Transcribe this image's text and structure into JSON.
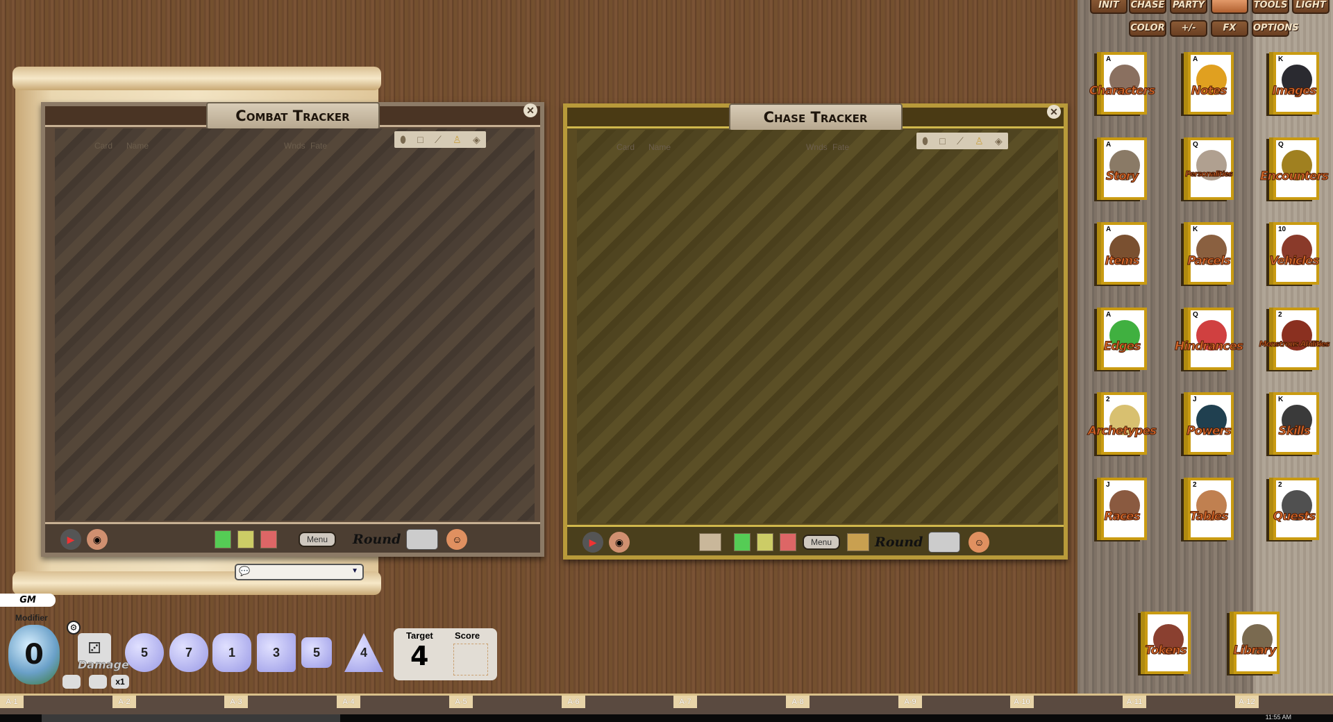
{
  "toolbar": {
    "row1": [
      "Init",
      "Chase",
      "Party",
      "",
      "Tools",
      "Light"
    ],
    "row2": [
      "Color",
      "+/-",
      "FX",
      "Options"
    ]
  },
  "combat_tracker": {
    "title": "Combat Tracker",
    "columns": {
      "card": "Card",
      "name": "Name",
      "wnds": "Wnds",
      "fate": "Fate"
    },
    "menu_label": "Menu",
    "round_label": "Round",
    "round_value": ""
  },
  "chase_tracker": {
    "title": "Chase Tracker",
    "columns": {
      "card": "Card",
      "name": "Name",
      "wnds": "Wnds",
      "fate": "Fate"
    },
    "menu_label": "Menu",
    "round_label": "Round",
    "round_value": ""
  },
  "chat": {
    "mode_value": ""
  },
  "identity": {
    "label": "GM"
  },
  "modifier": {
    "label": "Modifier",
    "value": "0"
  },
  "damage": {
    "label": "Damage",
    "multiplier": "x1"
  },
  "dice": [
    "d20",
    "d12",
    "d10",
    "d8",
    "d6",
    "d4"
  ],
  "dice_faces": [
    "5",
    "7",
    "1",
    "3",
    "5",
    "4"
  ],
  "target_score": {
    "target_label": "Target",
    "target_value": "4",
    "score_label": "Score",
    "score_value": ""
  },
  "library": [
    {
      "label": "Characters",
      "rank": "A",
      "color": "#8a7060"
    },
    {
      "label": "Notes",
      "rank": "A",
      "color": "#e0a020"
    },
    {
      "label": "Images",
      "rank": "K",
      "color": "#2a2a30"
    },
    {
      "label": "Story",
      "rank": "A",
      "color": "#8a7a66"
    },
    {
      "label": "Personalities",
      "rank": "Q",
      "color": "#b0a090"
    },
    {
      "label": "Encounters",
      "rank": "Q",
      "color": "#a08020"
    },
    {
      "label": "Items",
      "rank": "A",
      "color": "#7a5030"
    },
    {
      "label": "Parcels",
      "rank": "K",
      "color": "#8a6040"
    },
    {
      "label": "Vehicles",
      "rank": "10",
      "color": "#8a3a2a"
    },
    {
      "label": "Edges",
      "rank": "A",
      "color": "#40b040"
    },
    {
      "label": "Hindrances",
      "rank": "Q",
      "color": "#d04040"
    },
    {
      "label": "Monstrous Abilities",
      "rank": "2",
      "color": "#8a3020"
    },
    {
      "label": "Archetypes",
      "rank": "2",
      "color": "#d8c070"
    },
    {
      "label": "Powers",
      "rank": "J",
      "color": "#204050"
    },
    {
      "label": "Skills",
      "rank": "K",
      "color": "#3a3a3a"
    },
    {
      "label": "Races",
      "rank": "J",
      "color": "#8a5a40"
    },
    {
      "label": "Tables",
      "rank": "2",
      "color": "#c08050"
    },
    {
      "label": "Quests",
      "rank": "2",
      "color": "#505050"
    }
  ],
  "bottom_cards": [
    {
      "label": "Tokens",
      "rank": "",
      "color": "#8a4030"
    },
    {
      "label": "Library",
      "rank": "",
      "color": "#7a6a50"
    }
  ],
  "desktop_tabs": [
    "A-1",
    "A-2",
    "A-3",
    "A-4",
    "A-5",
    "A-6",
    "A-7",
    "A-8",
    "A-9",
    "A-10",
    "A-11",
    "A-12"
  ],
  "clock": "11:55 AM"
}
